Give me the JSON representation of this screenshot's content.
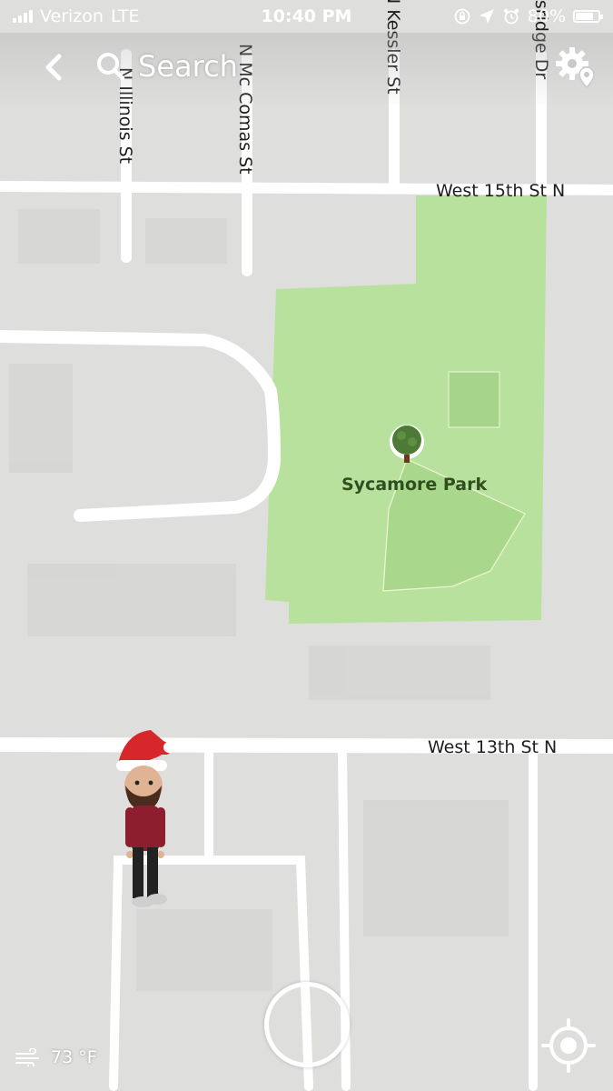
{
  "status_bar": {
    "carrier": "Verizon",
    "network": "LTE",
    "time": "10:40 PM",
    "battery": "80%",
    "battery_level": 0.8,
    "icons": [
      "orientation-lock-icon",
      "location-arrow-icon",
      "alarm-icon",
      "battery-icon"
    ]
  },
  "top_bar": {
    "back_icon": "chevron-left-icon",
    "search_icon": "search-icon",
    "search_placeholder": "Search",
    "settings_icon": "gear-location-icon"
  },
  "map": {
    "streets": {
      "n_illinois": "N Illinois St",
      "n_mc_comas": "N Mc Comas St",
      "n_kessler": "N Kessler St",
      "ridge_dr": "ssridge Dr",
      "west_15th": "West 15th St N",
      "west_13th": "West 13th St N"
    },
    "park": {
      "name": "Sycamore Park",
      "icon": "tree-icon",
      "color": "#b6e09a"
    },
    "avatar": "bitmoji-avatar",
    "road_color": "#ffffff",
    "background_color": "#dedfdd"
  },
  "bottom": {
    "weather_icon": "wind-icon",
    "temperature": "73 °F",
    "shutter": "camera-shutter-button",
    "locate_icon": "locate-crosshair-icon"
  }
}
